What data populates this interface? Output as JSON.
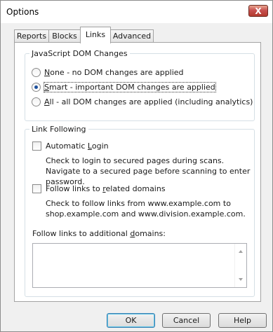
{
  "window": {
    "title": "Options",
    "close_glyph": "X"
  },
  "tabs": [
    {
      "label": "Reports",
      "active": false
    },
    {
      "label": "Blocks",
      "active": false
    },
    {
      "label": "Links",
      "active": true
    },
    {
      "label": "Advanced",
      "active": false
    }
  ],
  "dom_group": {
    "legend": "JavaScript DOM Changes",
    "options": [
      {
        "mnemonic": "N",
        "rest": "one - no DOM changes are applied",
        "checked": false
      },
      {
        "mnemonic": "S",
        "rest": "mart - important DOM changes are applied",
        "checked": true
      },
      {
        "mnemonic": "A",
        "rest": "ll - all DOM changes are applied (including analytics)",
        "checked": false
      }
    ]
  },
  "link_group": {
    "legend": "Link Following",
    "auto_login": {
      "label_before": "Automatic ",
      "mnemonic": "L",
      "label_after": "ogin",
      "checked": false,
      "description": "Check to login to secured pages during scans. Navigate to a secured page before scanning to enter password."
    },
    "related_domains": {
      "label_before": "Follow links to ",
      "mnemonic": "r",
      "label_after": "elated domains",
      "checked": false,
      "description": "Check to follow links from www.example.com to shop.example.com and www.division.example.com."
    },
    "additional_domains": {
      "label_before": "Follow links to additional ",
      "mnemonic": "d",
      "label_after": "omains:",
      "value": ""
    }
  },
  "buttons": {
    "ok": "OK",
    "cancel": "Cancel",
    "help": "Help"
  },
  "colors": {
    "accent": "#3c7fb1",
    "close": "#c75050",
    "radio_dot": "#1b4f9c"
  }
}
